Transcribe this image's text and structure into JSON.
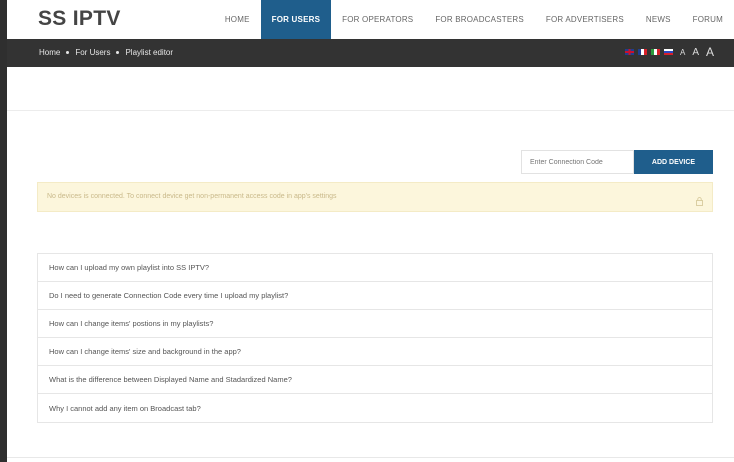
{
  "brand": {
    "logo": "SS IPTV"
  },
  "nav": {
    "items": [
      {
        "label": "HOME",
        "active": false
      },
      {
        "label": "FOR USERS",
        "active": true
      },
      {
        "label": "FOR OPERATORS",
        "active": false
      },
      {
        "label": "FOR BROADCASTERS",
        "active": false
      },
      {
        "label": "FOR ADVERTISERS",
        "active": false
      },
      {
        "label": "NEWS",
        "active": false
      },
      {
        "label": "FORUM",
        "active": false
      }
    ]
  },
  "breadcrumb": {
    "items": [
      "Home",
      "For Users",
      "Playlist editor"
    ]
  },
  "languages": [
    "uk-flag-icon",
    "fr-flag-icon",
    "it-flag-icon",
    "ru-flag-icon"
  ],
  "font_size": {
    "small": "A",
    "medium": "A",
    "large": "A"
  },
  "connection": {
    "placeholder": "Enter Connection Code",
    "button_label": "ADD DEVICE"
  },
  "notice": {
    "text": "No devices is connected. To connect device get non-permanent access code in app's settings"
  },
  "faq": {
    "items": [
      "How can I upload my own playlist into SS IPTV?",
      "Do I need to generate Connection Code every time I upload my playlist?",
      "How can I change items' postions in my playlists?",
      "How can I change items' size and background in the app?",
      "What is the difference between Displayed Name and Stadardized Name?",
      "Why I cannot add any item on Broadcast tab?"
    ]
  },
  "colors": {
    "accent": "#1f5e8c",
    "dark_bar": "#333333",
    "notice_bg": "#fcf6dc"
  }
}
